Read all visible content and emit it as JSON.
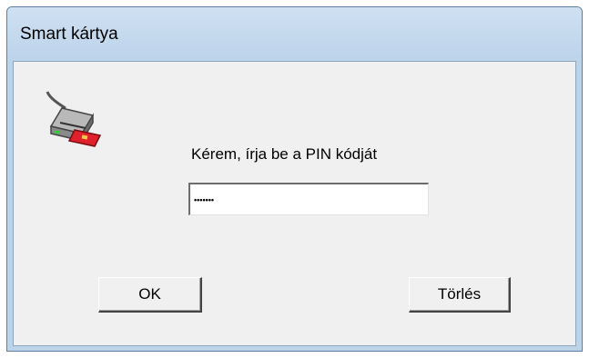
{
  "window": {
    "title": "Smart kártya"
  },
  "dialog": {
    "icon": "smart-card-reader-icon",
    "prompt": "Kérem, írja be a PIN kódját",
    "pin_value": "•••••••",
    "ok_label": "OK",
    "clear_label": "Törlés"
  },
  "colors": {
    "frame": "#bcd3ea",
    "client": "#f0f0f0",
    "card_red": "#e0202a",
    "led_green": "#3cc83c"
  }
}
